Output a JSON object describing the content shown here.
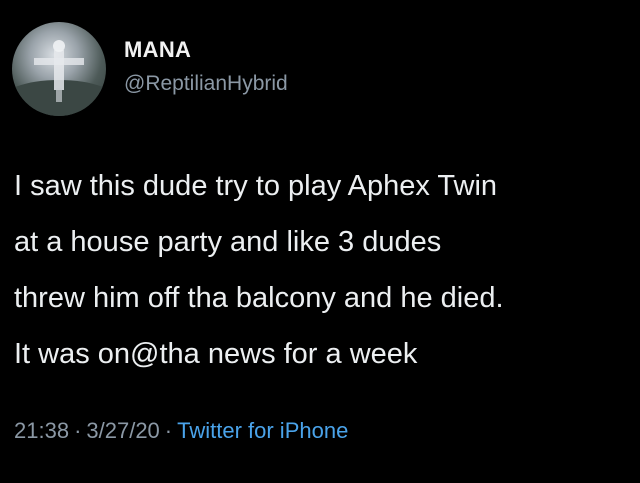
{
  "tweet": {
    "display_name": "MANA",
    "handle": "@ReptilianHybrid",
    "avatar_icon": "statue-avatar-icon",
    "body_lines": [
      "I saw this dude try to play Aphex Twin",
      "at a house party and like 3 dudes",
      "threw him off tha balcony and he died.",
      "It was on@tha news for a week"
    ],
    "time": "21:38",
    "separator": "·",
    "date": "3/27/20",
    "source": "Twitter for iPhone"
  },
  "colors": {
    "background": "#000000",
    "text": "#eceff1",
    "secondary_text": "#8b98a5",
    "link": "#4aa3ea"
  }
}
